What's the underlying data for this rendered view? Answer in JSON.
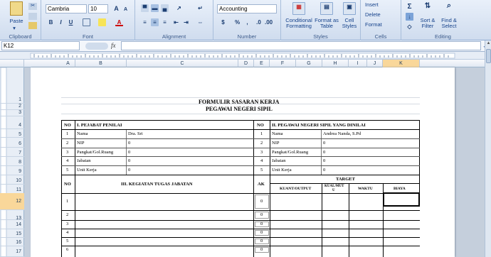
{
  "ribbon": {
    "clipboard": {
      "paste": "Paste",
      "label": "Clipboard"
    },
    "font": {
      "name": "Cambria",
      "size": "10",
      "label": "Font",
      "bold": "B",
      "italic": "I",
      "underline": "U",
      "grow": "A",
      "shrink": "A",
      "color": "A"
    },
    "alignment": {
      "label": "Alignment"
    },
    "number": {
      "format": "Accounting",
      "label": "Number",
      "currency": "$",
      "percent": "%",
      "comma": ","
    },
    "styles": {
      "conditional": "Conditional Formatting",
      "format_table": "Format as Table",
      "cell_styles": "Cell Styles",
      "label": "Styles"
    },
    "cells": {
      "insert": "Insert",
      "delete": "Delete",
      "format": "Format",
      "label": "Cells"
    },
    "editing": {
      "sum": "Σ",
      "sort": "Sort & Filter",
      "find": "Find & Select",
      "label": "Editing"
    }
  },
  "formula_bar": {
    "name_box": "K12",
    "fx": "fx",
    "value": ""
  },
  "columns": [
    "A",
    "B",
    "C",
    "D",
    "E",
    "F",
    "G",
    "H",
    "I",
    "J",
    "K"
  ],
  "rows": [
    "1",
    "2",
    "3",
    "4",
    "5",
    "6",
    "7",
    "8",
    "9",
    "10",
    "11",
    "12",
    "13",
    "14",
    "15",
    "16",
    "17"
  ],
  "form": {
    "title1": "FORMULIR SASARAN KERJA",
    "title2": "PEGAWAI NEGERI SIPIL",
    "no": "NO",
    "left_head": "I. PEJABAT PENILAI",
    "right_head": "II. PEGAWAI NEGERI SIPIL YANG DINILAI",
    "left_rows": [
      {
        "n": "1",
        "label": "Nama",
        "value": "Dra. Sri"
      },
      {
        "n": "2",
        "label": "NIP",
        "value": "0"
      },
      {
        "n": "3",
        "label": "Pangkat/Gol.Ruang",
        "value": "0"
      },
      {
        "n": "4",
        "label": "Jabatan",
        "value": "0"
      },
      {
        "n": "5",
        "label": "Unit Kerja",
        "value": "0"
      }
    ],
    "right_rows": [
      {
        "n": "1",
        "label": "Nama",
        "value": "Andrea Nanda, S.Pd"
      },
      {
        "n": "2",
        "label": "NIP",
        "value": "0"
      },
      {
        "n": "3",
        "label": "Pangkat/Gol.Ruang",
        "value": "0"
      },
      {
        "n": "4",
        "label": "Jabatan",
        "value": "0"
      },
      {
        "n": "5",
        "label": "Unit Kerja",
        "value": "0"
      }
    ],
    "activity_head": "III. KEGIATAN TUGAS JABATAN",
    "ak": "AK",
    "target": "TARGET",
    "kuant": "KUANT/OUTPUT",
    "kual": "KUAL/MUT",
    "kual2": "U",
    "waktu": "WAKTU",
    "biaya": "BIAYA",
    "activities": [
      {
        "n": "1",
        "ak": "0"
      },
      {
        "n": "2",
        "ak": "0"
      },
      {
        "n": "3",
        "ak": "0"
      },
      {
        "n": "4",
        "ak": "0"
      },
      {
        "n": "5",
        "ak": "0"
      },
      {
        "n": "6",
        "ak": "0"
      }
    ]
  }
}
